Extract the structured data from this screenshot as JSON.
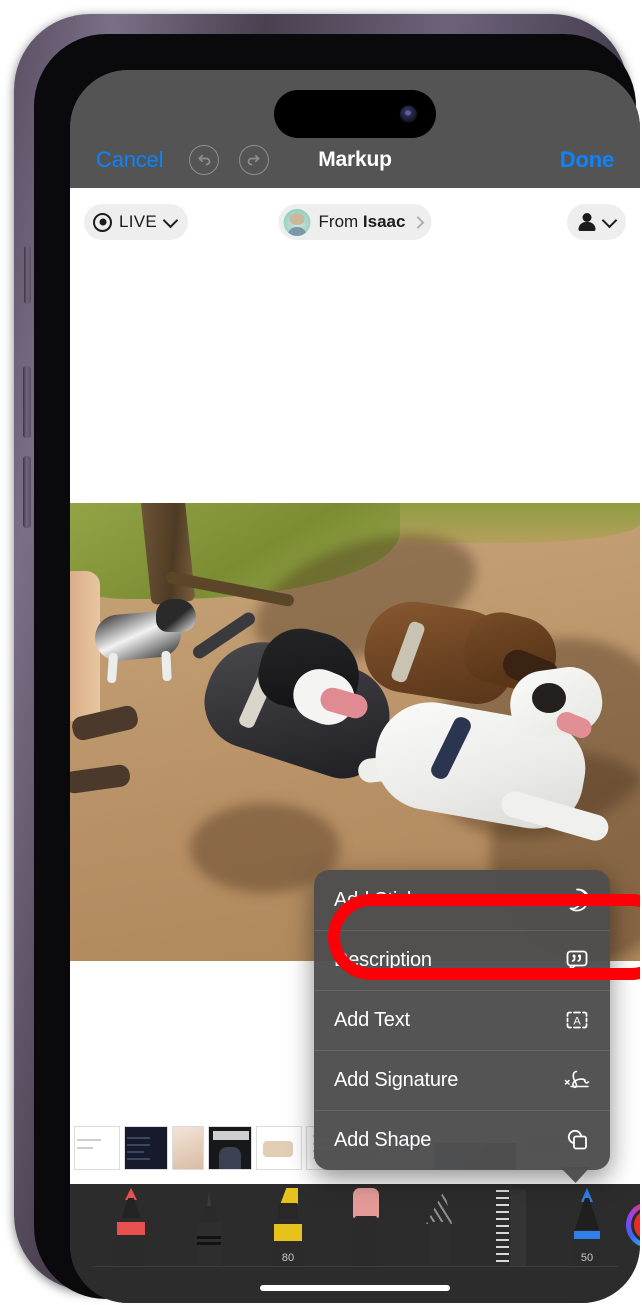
{
  "device": {
    "name": "iphone-14-pro",
    "frame_color": "#5a4f63"
  },
  "nav_bar": {
    "cancel_label": "Cancel",
    "title": "Markup",
    "done_label": "Done",
    "undo_icon": "undo-icon",
    "redo_icon": "redo-icon"
  },
  "header_chips": {
    "live": {
      "label": "LIVE",
      "icon": "live-photo-icon",
      "chevron": "chevron-down-icon"
    },
    "sender": {
      "prefix": "From ",
      "name": "Isaac",
      "avatar": "sender-avatar",
      "chevron": "chevron-right-icon"
    },
    "recipient": {
      "icon": "person-icon",
      "chevron": "chevron-down-icon"
    }
  },
  "attachment": {
    "type": "photo",
    "description": "Four dogs playing in a dirt dog park with grass and a tree; a person's legs in sandals at left"
  },
  "context_menu": {
    "items": [
      {
        "label": "Add Sticker",
        "icon": "sticker-icon",
        "highlighted": true
      },
      {
        "label": "Description",
        "icon": "description-icon",
        "highlighted": false
      },
      {
        "label": "Add Text",
        "icon": "text-box-icon",
        "highlighted": false
      },
      {
        "label": "Add Signature",
        "icon": "signature-icon",
        "highlighted": false
      },
      {
        "label": "Add Shape",
        "icon": "shape-icon",
        "highlighted": false
      }
    ],
    "highlight_color": "#fb0007"
  },
  "toolbar": {
    "tools": [
      {
        "name": "pen-tool",
        "color": "#e8504f",
        "label": ""
      },
      {
        "name": "pencil-tool",
        "color": "#2b2b2b",
        "label": ""
      },
      {
        "name": "highlighter-tool",
        "color": "#e8c21c",
        "label": "80"
      },
      {
        "name": "eraser-tool",
        "color": "#e49b98",
        "label": ""
      },
      {
        "name": "lasso-tool",
        "color": "#6a6a6a",
        "label": ""
      },
      {
        "name": "ruler-tool",
        "color": "#d8d8d8",
        "label": ""
      },
      {
        "name": "blue-pen-tool",
        "color": "#2f7fe8",
        "label": "50"
      }
    ],
    "color_well": {
      "name": "color-wheel",
      "selected_color": "#ec2a25"
    },
    "add_button": {
      "name": "add-tool-button",
      "label": "+"
    }
  },
  "colors": {
    "accent_blue": "#0a84ff",
    "nav_background": "#545454",
    "toolbar_background": "#2c2c2c",
    "menu_background": "#4e4e4e"
  }
}
